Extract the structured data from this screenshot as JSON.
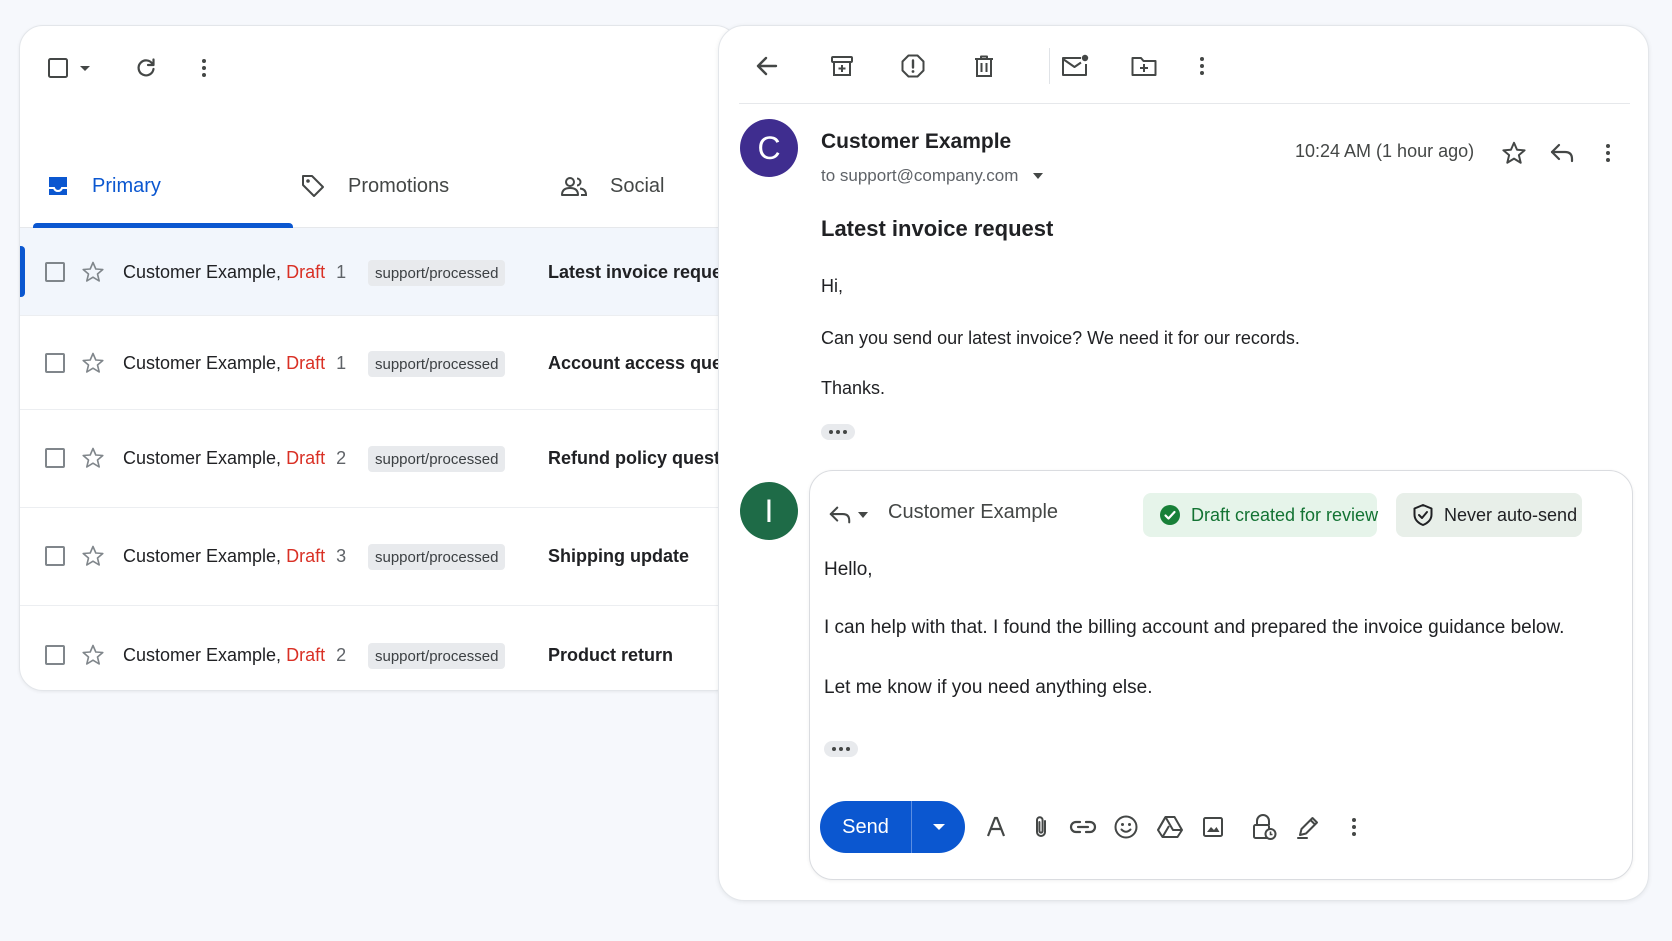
{
  "inbox": {
    "tabs": [
      {
        "label": "Primary",
        "icon": "inbox-icon"
      },
      {
        "label": "Promotions",
        "icon": "tag-icon"
      },
      {
        "label": "Social",
        "icon": "people-icon"
      }
    ],
    "rows": [
      {
        "sender": "Customer Example,",
        "draft": "Draft",
        "count": "1",
        "label": "support/processed",
        "subject": "Latest invoice request"
      },
      {
        "sender": "Customer Example,",
        "draft": "Draft",
        "count": "1",
        "label": "support/processed",
        "subject": "Account access question"
      },
      {
        "sender": "Customer Example,",
        "draft": "Draft",
        "count": "2",
        "label": "support/processed",
        "subject": "Refund policy question"
      },
      {
        "sender": "Customer Example,",
        "draft": "Draft",
        "count": "3",
        "label": "support/processed",
        "subject": "Shipping update"
      },
      {
        "sender": "Customer Example,",
        "draft": "Draft",
        "count": "2",
        "label": "support/processed",
        "subject": "Product return"
      }
    ]
  },
  "message": {
    "avatar_letter": "C",
    "avatar_color": "#3f2d8f",
    "sender": "Customer Example",
    "to": "to support@company.com",
    "time": "10:24 AM (1 hour ago)",
    "subject": "Latest invoice request",
    "body": {
      "greeting": "Hi,",
      "line1": "Can you send our latest invoice? We need it for our records.",
      "signoff": "Thanks."
    }
  },
  "reply": {
    "avatar_letter": "I",
    "avatar_color": "#1e6b47",
    "recipient": "Customer Example",
    "badges": {
      "review": "Draft created for review",
      "never": "Never auto-send"
    },
    "body": {
      "greeting": "Hello,",
      "line1": "I can help with that. I found the billing account and prepared the invoice guidance below.",
      "line2": "Let me know if you need anything else."
    },
    "send_label": "Send"
  },
  "colors": {
    "accent": "#0b57d0",
    "draft": "#d93025",
    "success": "#137333"
  }
}
